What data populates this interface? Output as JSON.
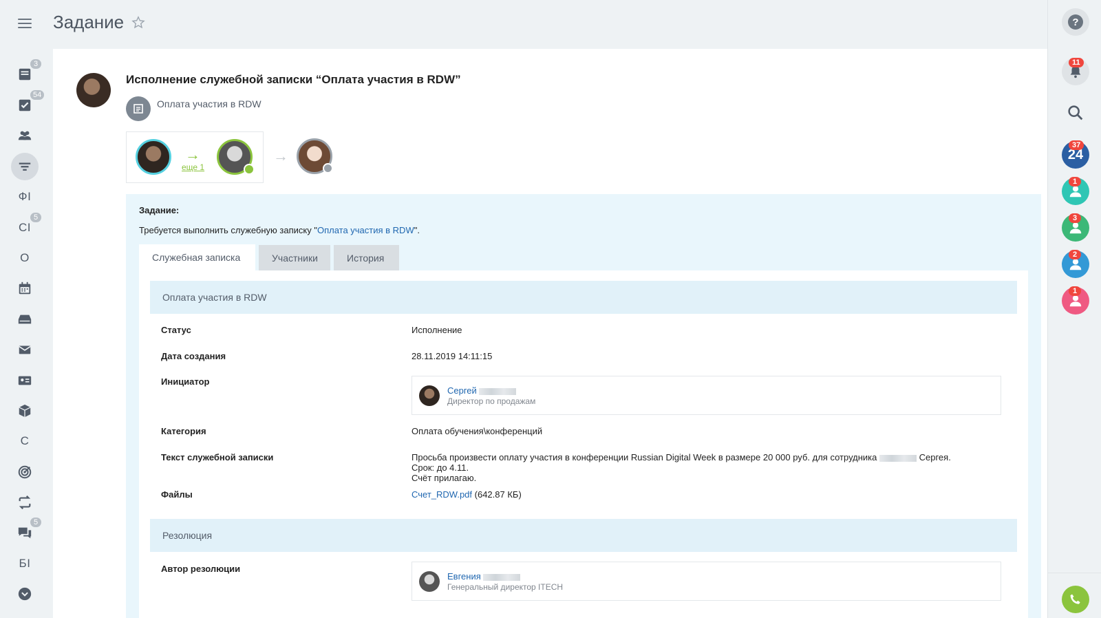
{
  "header": {
    "title": "Задание"
  },
  "left_nav": {
    "items": [
      {
        "name": "feed",
        "count": "3"
      },
      {
        "name": "tasks",
        "count": "54"
      },
      {
        "name": "groups"
      },
      {
        "name": "filter"
      },
      {
        "name": "letter-fi",
        "label": "ФІ"
      },
      {
        "name": "letter-ci",
        "label": "СІ",
        "count": "5"
      },
      {
        "name": "letter-o",
        "label": "О"
      },
      {
        "name": "calendar"
      },
      {
        "name": "drive"
      },
      {
        "name": "mail"
      },
      {
        "name": "contacts"
      },
      {
        "name": "box"
      },
      {
        "name": "letter-c",
        "label": "С"
      },
      {
        "name": "target"
      },
      {
        "name": "sync"
      },
      {
        "name": "chat",
        "count": "5"
      },
      {
        "name": "letter-bi",
        "label": "БІ"
      },
      {
        "name": "more"
      }
    ]
  },
  "task": {
    "title": "Исполнение служебной записки “Оплата участия в RDW”",
    "doc_subtitle": "Оплата участия в RDW",
    "flow_more": "еще 1",
    "label": "Задание:",
    "desc_prefix": "Требуется выполнить служебную записку \"",
    "desc_link": "Оплата участия в RDW",
    "desc_suffix": "\"."
  },
  "tabs": [
    {
      "label": "Служебная записка",
      "active": true
    },
    {
      "label": "Участники"
    },
    {
      "label": "История"
    }
  ],
  "memo": {
    "section_title": "Оплата участия в RDW",
    "status_label": "Статус",
    "status_value": "Исполнение",
    "created_label": "Дата создания",
    "created_value": "28.11.2019 14:11:15",
    "initiator_label": "Инициатор",
    "initiator_name": "Сергей",
    "initiator_position": "Директор по продажам",
    "category_label": "Категория",
    "category_value": "Оплата обучения\\конференций",
    "text_label": "Текст служебной записки",
    "text_line1_a": "Просьба произвести оплату участия в конференции Russian Digital Week в размере 20 000 руб. для сотрудника",
    "text_line1_b": "Сергея.",
    "text_line2": "Срок: до 4.11.",
    "text_line3": "Счёт прилагаю.",
    "files_label": "Файлы",
    "file_name": "Счет_RDW.pdf",
    "file_size": "(642.87 КБ)"
  },
  "resolution": {
    "section_title": "Резолюция",
    "author_label": "Автор резолюции",
    "author_name": "Евгения",
    "author_position": "Генеральный директор ITECH"
  },
  "right_bar": {
    "help": "?",
    "notifications_count": "11",
    "b24_label": "24",
    "b24_count": "37",
    "user_counts": [
      "1",
      "3",
      "2",
      "1"
    ],
    "colors": {
      "teal": "#2fc6b4",
      "green": "#3cb877",
      "blue": "#3399d6",
      "pink": "#ef5a82",
      "b24": "#2b5fa3",
      "call": "#8bc43d"
    }
  }
}
